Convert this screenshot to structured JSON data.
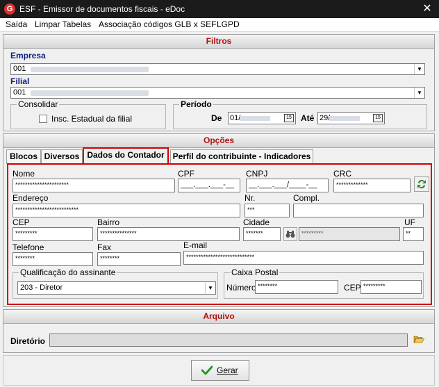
{
  "window": {
    "title": "ESF - Emissor de documentos fiscais - eDoc",
    "app_icon": "G",
    "close_glyph": "✕"
  },
  "menu": [
    "Saída",
    "Limpar Tabelas",
    "Associação códigos GLB x SEF",
    "LGPD"
  ],
  "filtros": {
    "header": "Filtros",
    "empresa_label": "Empresa",
    "empresa_value": "001",
    "filial_label": "Filial",
    "filial_value": "001",
    "consolidar_title": "Consolidar",
    "consolidar_checkbox": "Insc. Estadual da filial",
    "periodo_title": "Período",
    "de_label": "De",
    "de_value": "01/",
    "ate_label": "Até",
    "ate_value": "29/",
    "calendar_glyph": "15"
  },
  "opcoes": {
    "header": "Opções",
    "tabs": [
      "Blocos",
      "Diversos",
      "Dados do Contador",
      "Perfil do contribuinte - Indicadores"
    ],
    "active_tab": "Dados do Contador",
    "labels": {
      "nome": "Nome",
      "cpf": "CPF",
      "cnpj": "CNPJ",
      "crc": "CRC",
      "endereco": "Endereço",
      "nr": "Nr.",
      "compl": "Compl.",
      "cep": "CEP",
      "bairro": "Bairro",
      "cidade": "Cidade",
      "uf": "UF",
      "telefone": "Telefone",
      "fax": "Fax",
      "email": "E-mail",
      "qualificacao": "Qualificação do assinante",
      "caixa_postal": "Caixa Postal",
      "numero": "Número",
      "cep2": "CEP"
    },
    "values": {
      "nome": "**********************",
      "cpf": "___.___.___-__",
      "cnpj": "__.___.___/____-__",
      "crc": "*************",
      "endereco": "**************************",
      "nr": "***",
      "cep": "*********",
      "bairro": "***************",
      "cidade": "*******",
      "cidade_nome": "*********",
      "uf": "**",
      "telefone": "********",
      "fax": "********",
      "email": "****************************",
      "qualificacao": "203 - Diretor",
      "cp_numero": "********",
      "cp_cep": "*********"
    }
  },
  "arquivo": {
    "header": "Arquivo",
    "diretorio_label": "Diretório"
  },
  "gerar_button": "Gerar",
  "icons": {
    "refresh": "refresh-icon",
    "search": "binoculars-icon",
    "folder": "folder-open-icon",
    "check": "check-icon"
  },
  "colors": {
    "section_title": "#b01010",
    "field_label_blue": "#102080",
    "highlight_red": "#d00000"
  }
}
